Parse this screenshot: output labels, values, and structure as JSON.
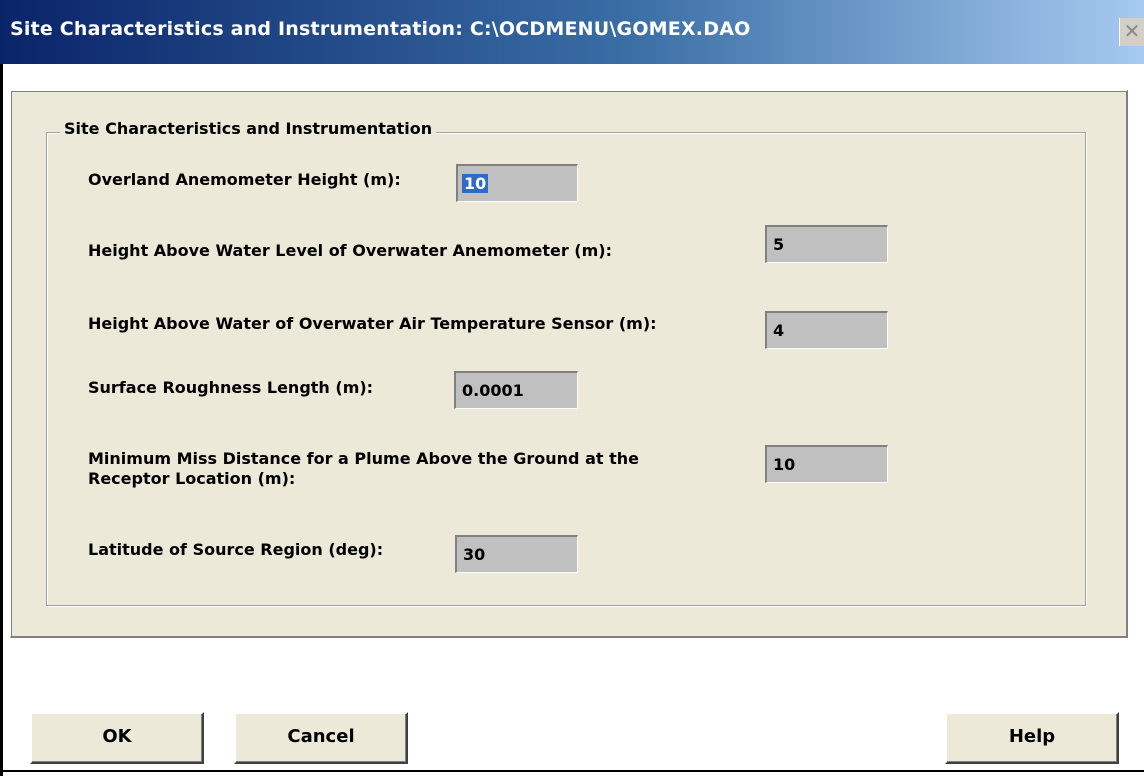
{
  "window": {
    "title": "Site Characteristics and Instrumentation: C:\\OCDMENU\\GOMEX.DAO",
    "close_icon": "close-icon"
  },
  "group": {
    "legend": "Site Characteristics and Instrumentation"
  },
  "fields": {
    "overland_height": {
      "label": "Overland Anemometer Height (m):",
      "value": "10"
    },
    "overwater_anemometer": {
      "label": "Height Above Water Level of Overwater Anemometer (m):",
      "value": "5"
    },
    "air_temp_sensor": {
      "label": "Height Above Water of Overwater Air Temperature Sensor (m):",
      "value": "4"
    },
    "roughness": {
      "label": "Surface Roughness Length (m):",
      "value": "0.0001"
    },
    "miss_distance": {
      "label_line1": "Minimum Miss Distance for a Plume Above the Ground at the",
      "label_line2": "Receptor Location (m):",
      "value": "10"
    },
    "latitude": {
      "label": "Latitude of Source Region (deg):",
      "value": "30"
    }
  },
  "buttons": {
    "ok": "OK",
    "cancel": "Cancel",
    "help": "Help"
  }
}
